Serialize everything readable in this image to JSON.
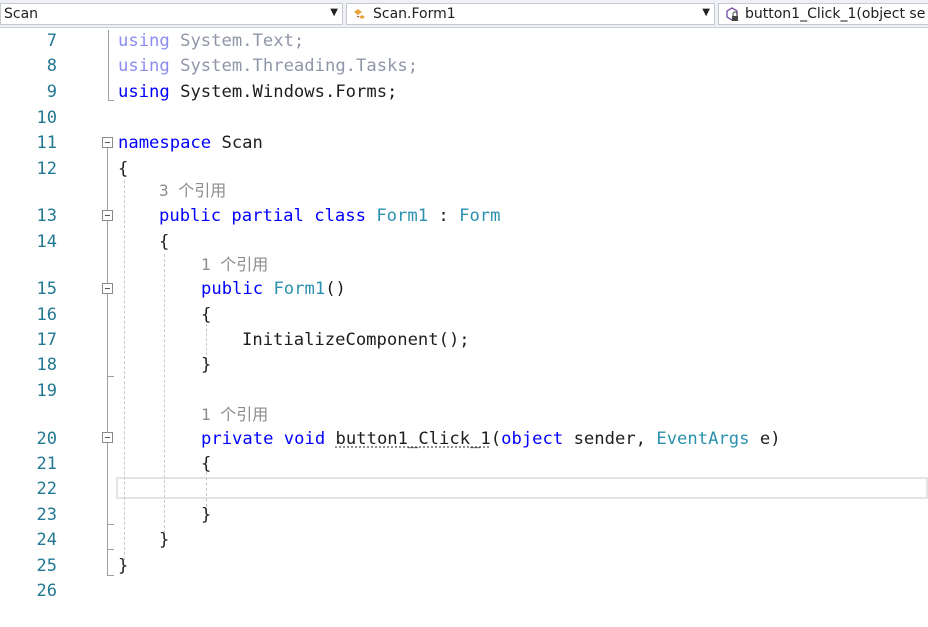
{
  "navbar": {
    "project_dropdown": "Scan",
    "class_dropdown": "Scan.Form1",
    "member_dropdown": "button1_Click_1(object se"
  },
  "editor": {
    "line_numbers": [
      "7",
      "8",
      "9",
      "10",
      "11",
      "12",
      "13",
      "14",
      "15",
      "16",
      "17",
      "18",
      "19",
      "20",
      "21",
      "22",
      "23",
      "24",
      "25",
      "26"
    ],
    "code": {
      "l7_kw": "using",
      "l7_rest": " System.Text;",
      "l8_kw": "using",
      "l8_rest": " System.Threading.Tasks;",
      "l9_kw": "using",
      "l9_rest": " System.Windows.Forms;",
      "l11_kw": "namespace",
      "l11_rest": " Scan",
      "l12": "{",
      "lens_class": "3 个引用",
      "l13_kw": "public partial class",
      "l13_name": " Form1",
      "l13_colon": " : ",
      "l13_base": "Form",
      "l14": "{",
      "lens_ctor": "1 个引用",
      "l15_kw": "public",
      "l15_name": " Form1",
      "l15_rest": "()",
      "l16": "{",
      "l17": "InitializeComponent();",
      "l18": "}",
      "lens_method": "1 个引用",
      "l20_kw": "private void",
      "l20_name": "button1_Click_1",
      "l20_open": "(",
      "l20_kw2": "object",
      "l20_mid": " sender, ",
      "l20_type": "EventArgs",
      "l20_end": " e)",
      "l21": "{",
      "l23": "}",
      "l24": "}",
      "l25": "}"
    }
  },
  "colors": {
    "keyword": "#0000ff",
    "type": "#2b91af",
    "line_number": "#237893",
    "faded": "#8f96a8"
  }
}
